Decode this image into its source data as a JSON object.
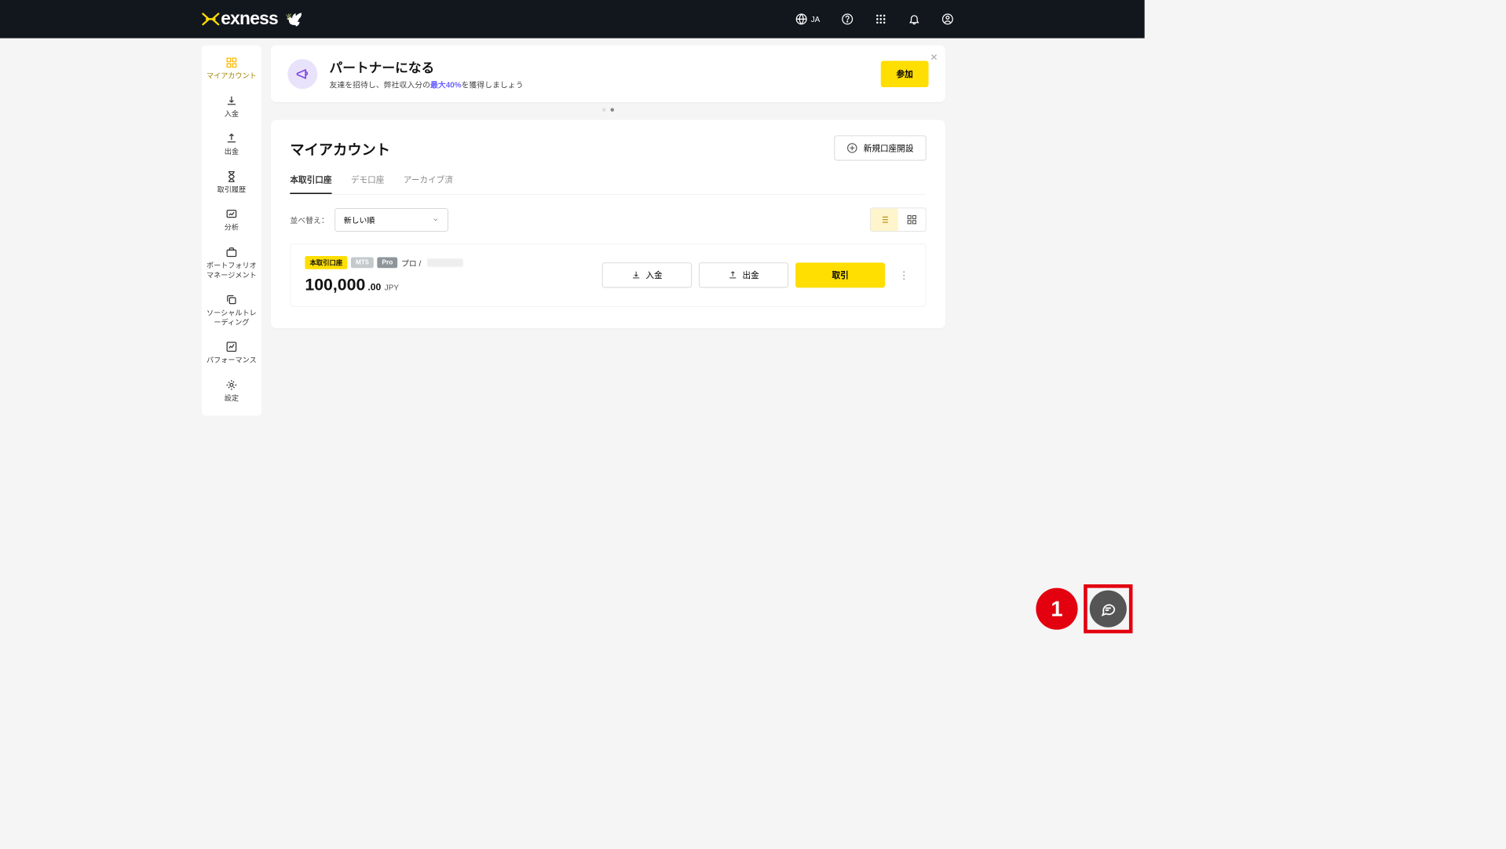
{
  "header": {
    "brand": "exness",
    "lang_label": "JA"
  },
  "sidebar": {
    "items": [
      {
        "label": "マイアカウント"
      },
      {
        "label": "入金"
      },
      {
        "label": "出金"
      },
      {
        "label": "取引履歴"
      },
      {
        "label": "分析"
      },
      {
        "label": "ポートフォリオマネージメント"
      },
      {
        "label": "ソーシャルトレーディング"
      },
      {
        "label": "パフォーマンス"
      },
      {
        "label": "設定"
      }
    ]
  },
  "banner": {
    "title": "パートナーになる",
    "subtitle_pre": "友達を招待し、弊社収入分の",
    "subtitle_hl": "最大40%",
    "subtitle_post": "を獲得しましょう",
    "join": "参加"
  },
  "card": {
    "title": "マイアカウント",
    "new_account": "新規口座開設"
  },
  "tabs": {
    "real": "本取引口座",
    "demo": "デモ口座",
    "archive": "アーカイブ済"
  },
  "sort": {
    "label": "並べ替え：",
    "value": "新しい順"
  },
  "account": {
    "badge_real": "本取引口座",
    "badge_mt5": "MT5",
    "badge_pro": "Pro",
    "name_prefix": "プロ /",
    "balance_whole": "100,000",
    "balance_frac": ".00",
    "currency": "JPY",
    "deposit": "入金",
    "withdraw": "出金",
    "trade": "取引"
  },
  "overlay": {
    "step": "1"
  }
}
